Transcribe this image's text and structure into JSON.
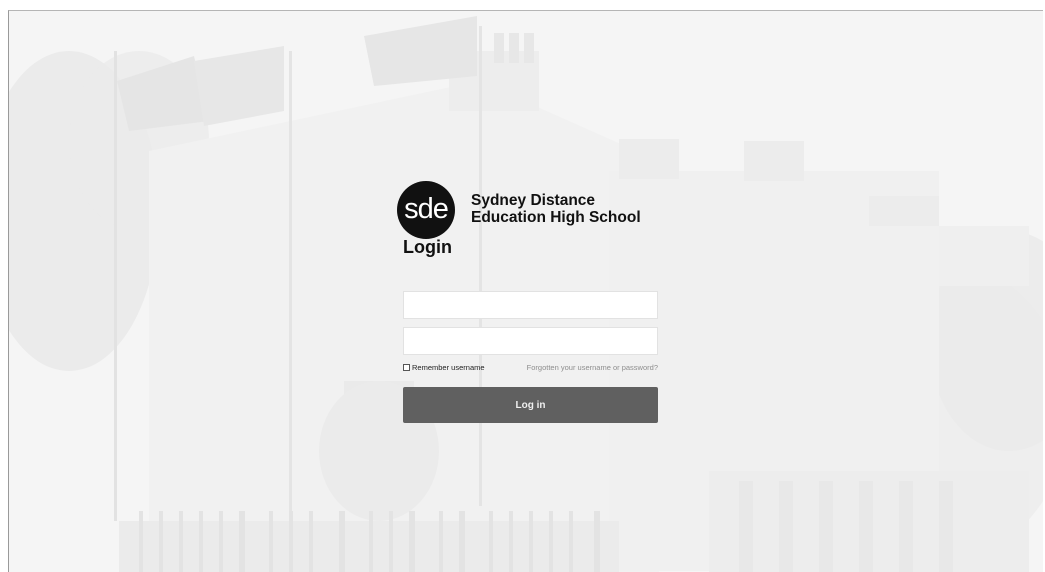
{
  "branding": {
    "logo_text": "sde",
    "school_name_line1": "Sydney Distance",
    "school_name_line2": "Education High School"
  },
  "login": {
    "heading": "Login",
    "username_value": "",
    "password_value": "",
    "remember_label": "Remember username",
    "remember_checked": false,
    "forgot_link": "Forgotten your username or password?",
    "submit_label": "Log in"
  },
  "colors": {
    "button_bg": "#606060",
    "link_text": "#8e8e8e",
    "logo_bg": "#111111"
  }
}
